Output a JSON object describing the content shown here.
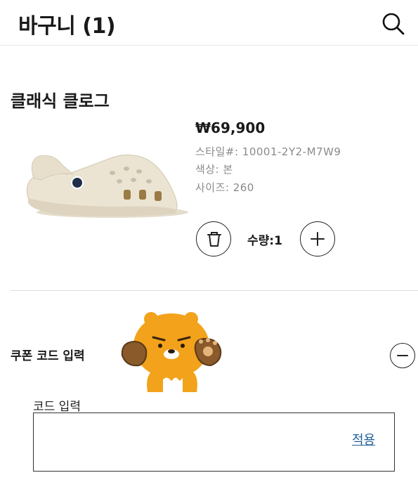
{
  "header": {
    "title": "바구니 (1)",
    "search_icon": "search-icon"
  },
  "product": {
    "name": "클래식 클로그",
    "price": "₩69,900",
    "style": "스타일#: 10001-2Y2-M7W9",
    "color": "색상: 본",
    "size": "사이즈: 260",
    "quantity_label": "수량:1",
    "image_color": "#ece4d3",
    "delete_icon": "trash-icon",
    "add_icon": "plus-icon"
  },
  "coupon": {
    "label": "쿠폰 코드 입력",
    "collapse_icon": "minus-circle-icon",
    "code_label": "코드 입력",
    "input_value": "",
    "apply_label": "적용",
    "link_color": "#1f5f99"
  },
  "sticker": {
    "icon": "bear-character-sticker",
    "color": "#f2a21b"
  }
}
